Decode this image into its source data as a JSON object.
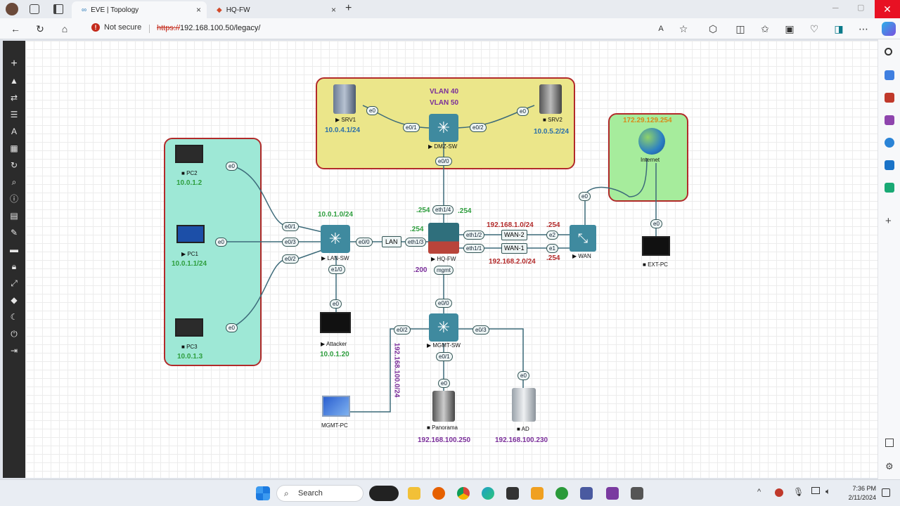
{
  "browser": {
    "tabs": [
      {
        "label": "EVE | Topology"
      },
      {
        "label": "HQ-FW"
      }
    ],
    "security_label": "Not secure",
    "url_scheme": "https://",
    "url_rest": "192.168.100.50/legacy/"
  },
  "topology": {
    "dmz": {
      "vlan1": "VLAN 40",
      "vlan2": "VLAN 50",
      "srv1": {
        "name": "SRV1",
        "ip": "10.0.4.1/24",
        "port": "e0"
      },
      "srv2": {
        "name": "SRV2",
        "ip": "10.0.5.2/24",
        "port": "e0"
      },
      "switch": {
        "name": "DMZ-SW",
        "ports": [
          "e0/1",
          "e0/2",
          "e0/0"
        ]
      }
    },
    "lan_area": {
      "pc2": {
        "name": "PC2",
        "ip": "10.0.1.2",
        "port": "e0"
      },
      "pc1": {
        "name": "PC1",
        "ip": "10.0.1.1/24",
        "port": "e0"
      },
      "pc3": {
        "name": "PC3",
        "ip": "10.0.1.3",
        "port": "e0"
      }
    },
    "lan_sw": {
      "name": "LAN-SW",
      "subnet": "10.0.1.0/24",
      "ports": [
        "e0/1",
        "e0/3",
        "e0/2",
        "e0/0",
        "e1/0"
      ],
      "lan_tag": "LAN"
    },
    "attacker": {
      "name": "Attacker",
      "ip": "10.0.1.20",
      "port": "e0"
    },
    "fw": {
      "name": "HQ-FW",
      "ports": [
        "eth1/4",
        "eth1/3",
        "eth1/2",
        "eth1/1",
        "mgmt"
      ],
      "addr_254a": ".254",
      "addr_254b": ".254",
      "addr_254c": ".254",
      "addr_200": ".200"
    },
    "wan_links": {
      "wan2": "WAN-2",
      "wan1": "WAN-1",
      "net1": "192.168.1.0/24",
      "net2": "192.168.2.0/24",
      "h1": ".254",
      "h2": ".254"
    },
    "wan": {
      "name": "WAN",
      "ports": [
        "e2",
        "e1",
        "e0"
      ]
    },
    "internet": {
      "name": "Internet",
      "ip": "172.29.129.254"
    },
    "ext_pc": {
      "name": "EXT-PC",
      "port": "e0"
    },
    "mgmt_sw": {
      "name": "MGMT-SW",
      "ports": [
        "e0/0",
        "e0/2",
        "e0/3",
        "e0/1"
      ],
      "subnet": "192.168.100.0/24"
    },
    "mgmt_pc": {
      "name": "MGMT-PC"
    },
    "panorama": {
      "name": "Panorama",
      "ip": "192.168.100.250",
      "port": "e0"
    },
    "ad": {
      "name": "AD",
      "ip": "192.168.100.230",
      "port": "e0"
    }
  },
  "taskbar": {
    "search_label": "Search",
    "time": "7:36 PM",
    "date": "2/11/2024"
  }
}
